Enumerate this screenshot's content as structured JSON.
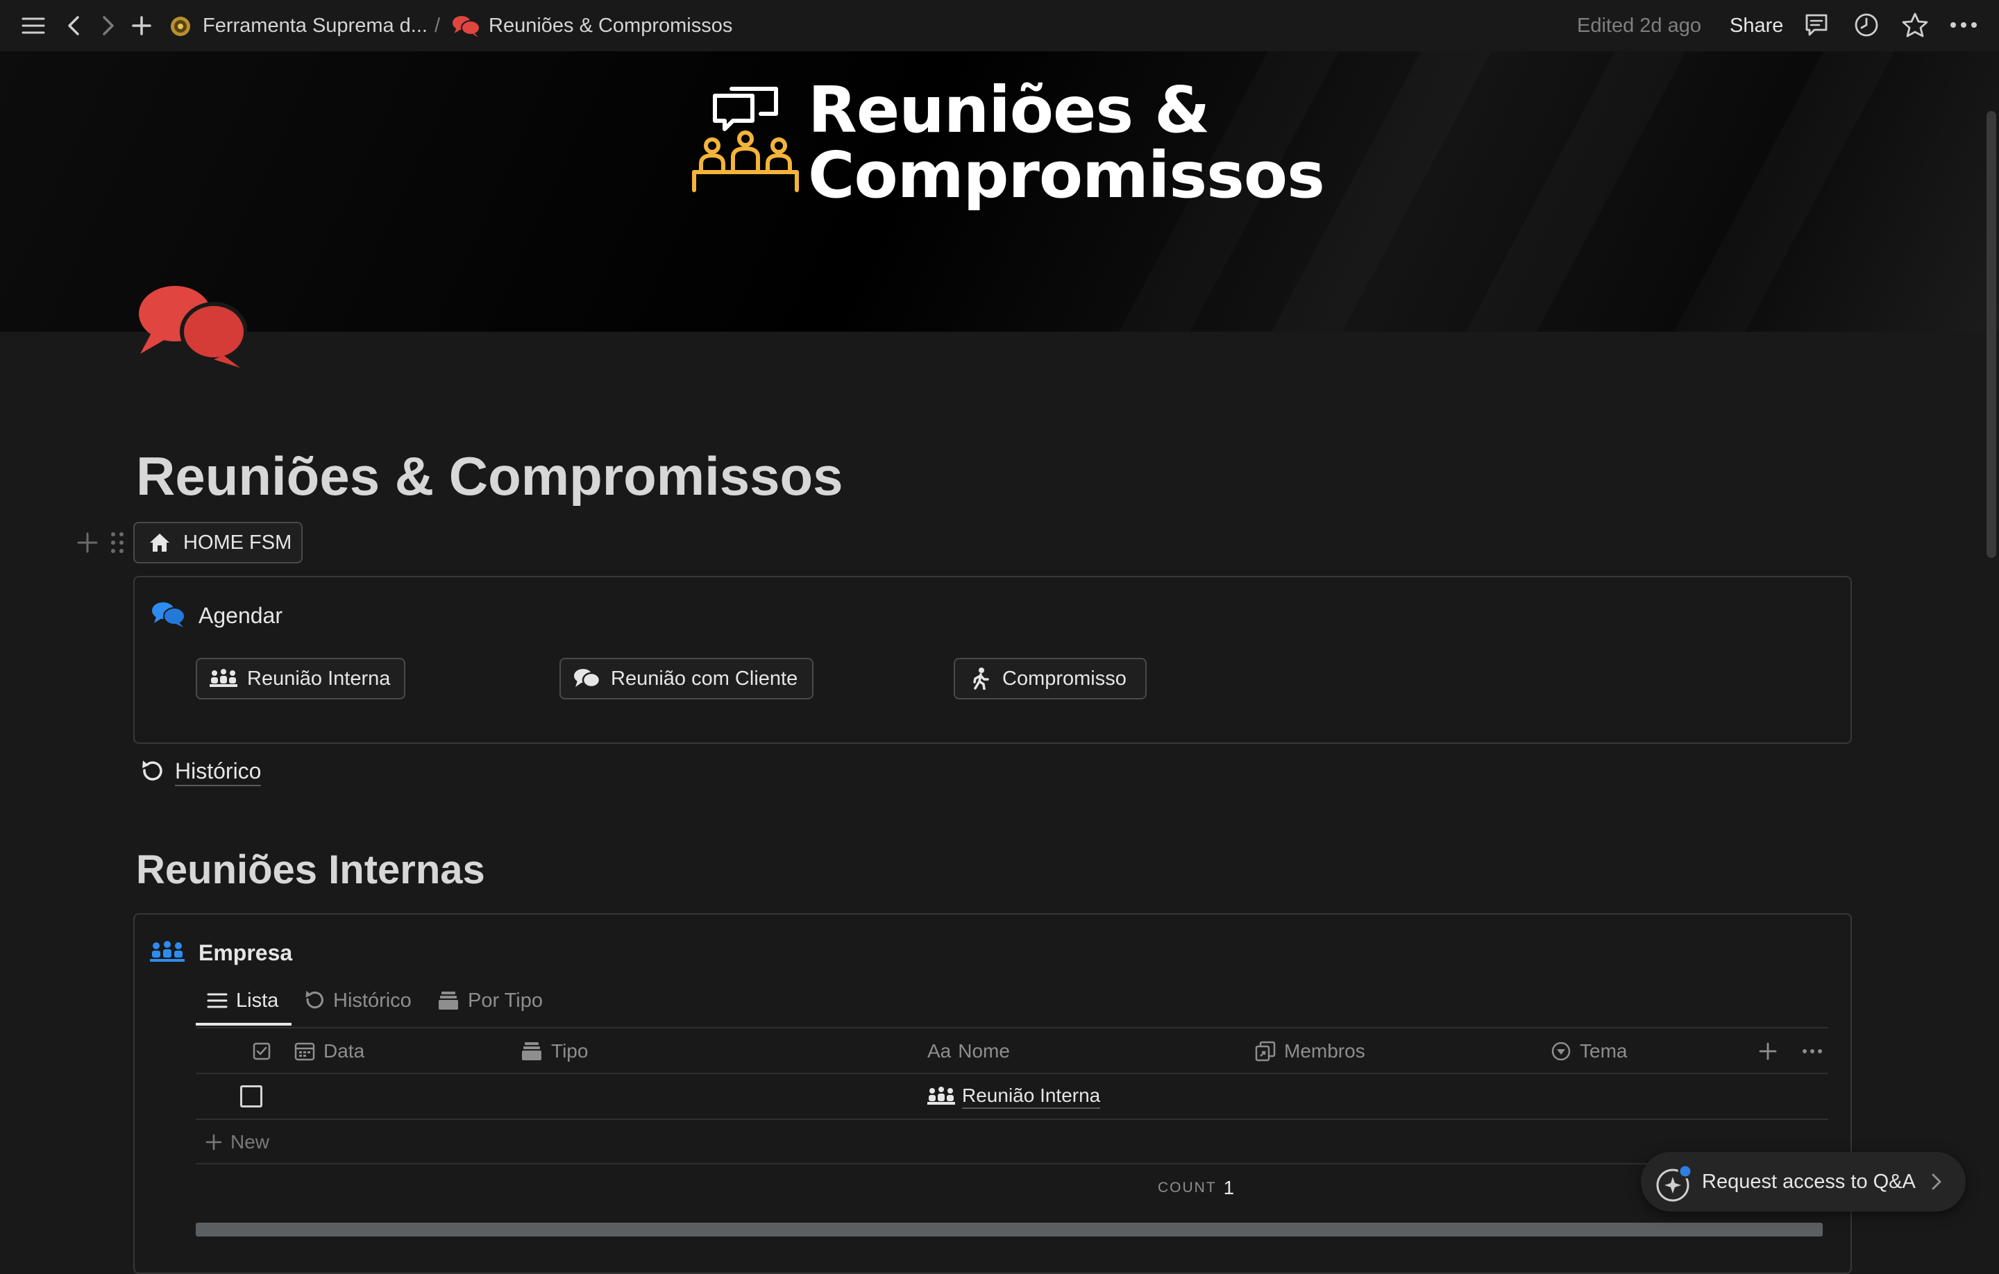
{
  "topbar": {
    "breadcrumb_workspace": "Ferramenta Suprema d...",
    "breadcrumb_separator": "/",
    "breadcrumb_page": "Reuniões & Compromissos",
    "edited": "Edited 2d ago",
    "share": "Share"
  },
  "cover": {
    "title_line1": "Reuniões &",
    "title_line2": "Compromissos"
  },
  "page": {
    "title": "Reuniões & Compromissos",
    "home_button": "HOME FSM"
  },
  "callout": {
    "title": "Agendar",
    "buttons": [
      "Reunião Interna",
      "Reunião com Cliente",
      "Compromisso"
    ]
  },
  "historico_link": "Histórico",
  "section_heading": "Reuniões Internas",
  "database": {
    "title": "Empresa",
    "tabs": [
      "Lista",
      "Histórico",
      "Por Tipo"
    ],
    "columns": [
      "Data",
      "Tipo",
      "Nome",
      "Membros",
      "Tema"
    ],
    "nome_prefix": "Aa",
    "rows": [
      {
        "checked": false,
        "data": "",
        "tipo": "",
        "nome": "Reunião Interna",
        "membros": "",
        "tema": ""
      }
    ],
    "new_label": "New",
    "count_label": "COUNT",
    "count_value": "1"
  },
  "qa_pill": "Request access to Q&A",
  "colors": {
    "background": "#191919",
    "accent_red": "#e0453f",
    "accent_blue": "#2e8cf0",
    "cover_gold": "#f4b43a",
    "qa_badge": "#2d7fe0"
  }
}
